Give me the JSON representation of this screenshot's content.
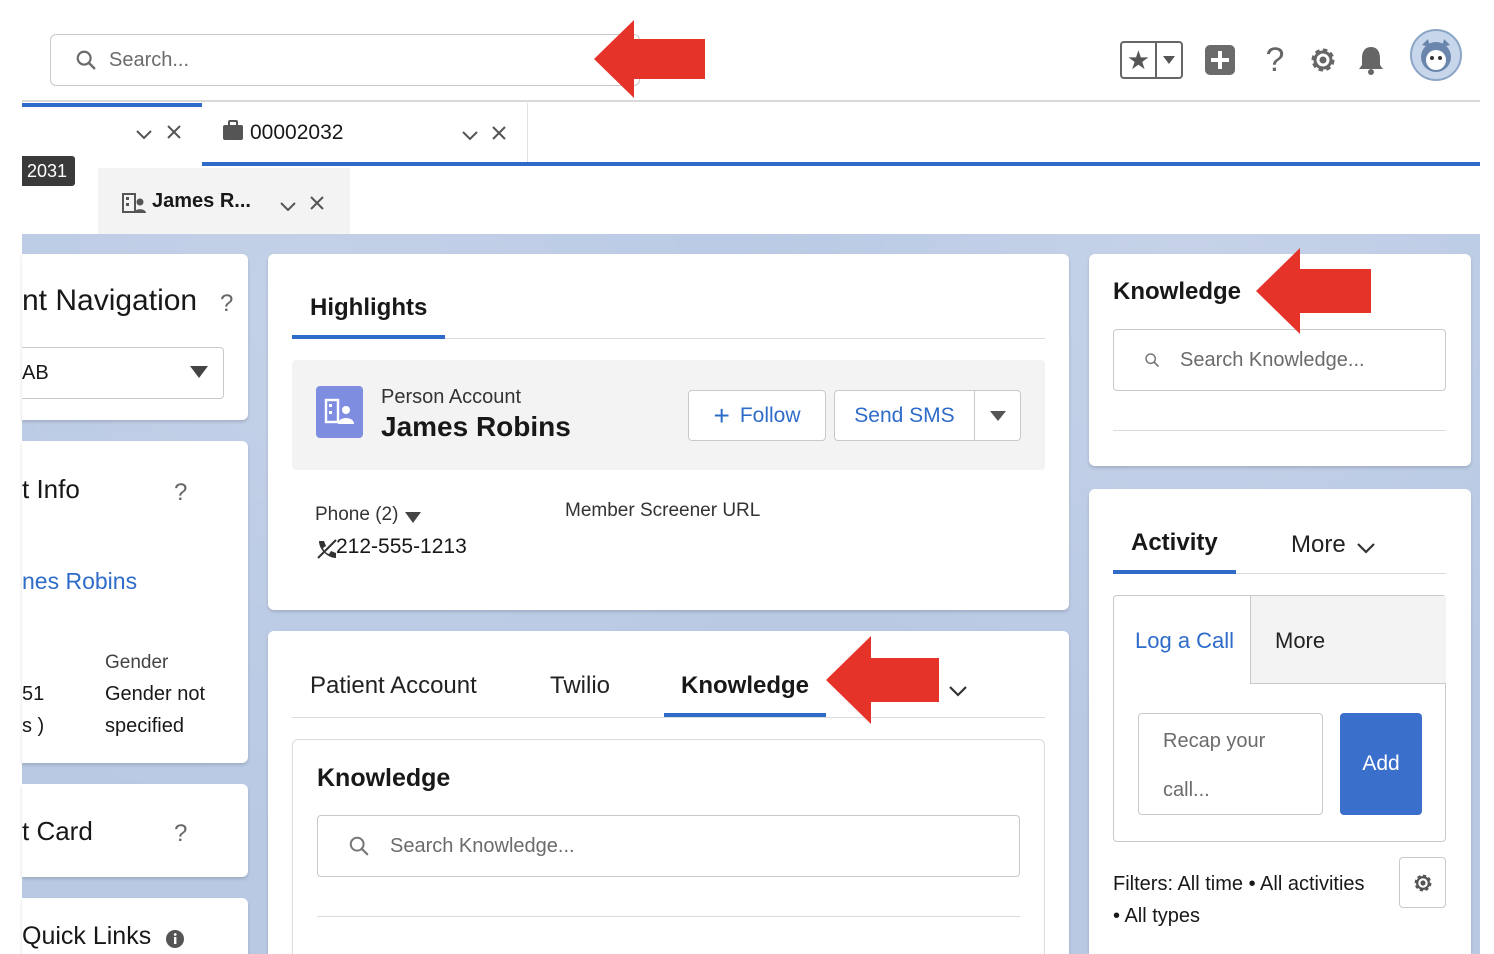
{
  "header": {
    "search_placeholder": "Search...",
    "icons": [
      "favorites-icon",
      "add-icon",
      "help-icon",
      "setup-gear-icon",
      "notifications-bell-icon",
      "user-avatar"
    ]
  },
  "tabs": {
    "tab1_label": "",
    "tab2_label": "00002032",
    "tooltip": "2031",
    "subtab_label": "James R..."
  },
  "left_column": {
    "navigation_title": "nt Navigation",
    "navigation_select": "AB",
    "info_title": "t Info",
    "info_name": "nes Robins",
    "gender_label": "Gender",
    "gender_value_line1": "Gender not",
    "gender_value_line2": "specified",
    "left_partial_1": "51",
    "left_partial_2": "s )",
    "card_title": "t Card",
    "quick_links_title": "Quick Links"
  },
  "highlights": {
    "tab_label": "Highlights",
    "record_type": "Person Account",
    "record_name": "James Robins",
    "follow_label": "Follow",
    "send_sms_label": "Send SMS",
    "phone_label": "Phone (2)",
    "phone_value": "212-555-1213",
    "member_screener_label": "Member Screener URL"
  },
  "center_tabs": {
    "tab_patient_account": "Patient Account",
    "tab_twilio": "Twilio",
    "tab_knowledge": "Knowledge",
    "knowledge_title": "Knowledge",
    "knowledge_search_placeholder": "Search Knowledge..."
  },
  "right_column": {
    "knowledge_title": "Knowledge",
    "knowledge_search_placeholder": "Search Knowledge...",
    "activity_tab": "Activity",
    "more_tab": "More",
    "log_call_tab": "Log a Call",
    "log_more_tab": "More",
    "recap_placeholder_line1": "Recap your",
    "recap_placeholder_line2": "call...",
    "add_button": "Add",
    "filters_line1": "Filters: All time • All activities",
    "filters_line2": "• All types"
  },
  "colors": {
    "accent_blue": "#2f6cc9",
    "annotation_red": "#e5332a",
    "body_background": "#b9c9e4",
    "record_icon_purple": "#7f8de1"
  }
}
